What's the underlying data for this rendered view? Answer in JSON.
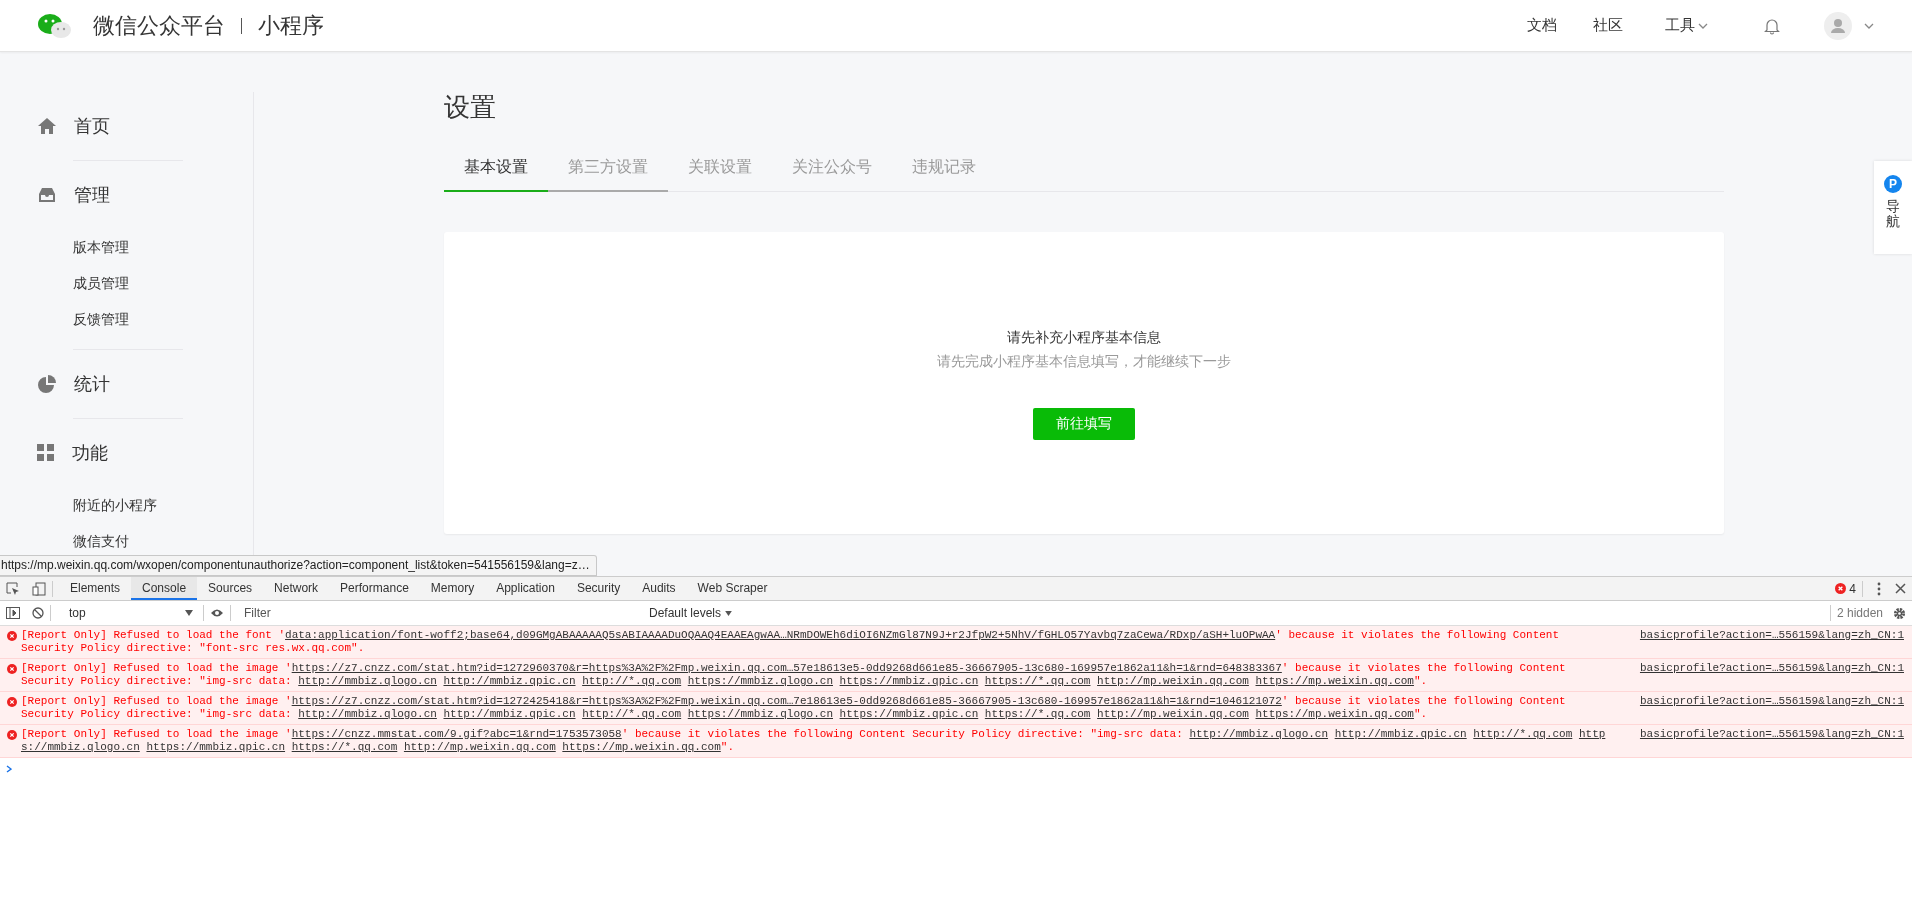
{
  "header": {
    "brand": "微信公众平台",
    "product": "小程序",
    "nav": [
      {
        "label": "文档",
        "kind": "link"
      },
      {
        "label": "社区",
        "kind": "link"
      },
      {
        "label": "工具",
        "kind": "menu"
      }
    ]
  },
  "sidebar": {
    "sections": [
      {
        "label": "首页"
      },
      {
        "label": "管理",
        "children": [
          {
            "label": "版本管理"
          },
          {
            "label": "成员管理"
          },
          {
            "label": "反馈管理"
          }
        ]
      },
      {
        "label": "统计"
      },
      {
        "label": "功能",
        "children": [
          {
            "label": "附近的小程序"
          },
          {
            "label": "微信支付"
          }
        ]
      }
    ]
  },
  "page": {
    "title": "设置",
    "tabs": [
      {
        "label": "基本设置",
        "selected": true,
        "hovered": false
      },
      {
        "label": "第三方设置",
        "selected": false,
        "hovered": true
      },
      {
        "label": "关联设置",
        "selected": false,
        "hovered": false
      },
      {
        "label": "关注公众号",
        "selected": false,
        "hovered": false
      },
      {
        "label": "违规记录",
        "selected": false,
        "hovered": false
      }
    ],
    "card": {
      "title": "请先补充小程序基本信息",
      "subtitle": "请先完成小程序基本信息填写，才能继续下一步",
      "button": "前往填写"
    }
  },
  "float_nav": {
    "badge": "P",
    "label": "导航"
  },
  "status_url": "https://mp.weixin.qq.com/wxopen/componentunauthorize?action=component_list&token=541556159&lang=z…",
  "devtools": {
    "tabs": [
      {
        "label": "Elements",
        "selected": false
      },
      {
        "label": "Console",
        "selected": true
      },
      {
        "label": "Sources",
        "selected": false
      },
      {
        "label": "Network",
        "selected": false
      },
      {
        "label": "Performance",
        "selected": false
      },
      {
        "label": "Memory",
        "selected": false
      },
      {
        "label": "Application",
        "selected": false
      },
      {
        "label": "Security",
        "selected": false
      },
      {
        "label": "Audits",
        "selected": false
      },
      {
        "label": "Web Scraper",
        "selected": false
      }
    ],
    "error_count": "4",
    "context": "top",
    "filter": {
      "placeholder": "Filter"
    },
    "levels": "Default levels",
    "hidden": "2 hidden",
    "messages": [
      {
        "source": "basicprofile?action=…556159&lang=zh_CN:1",
        "lines": [
          [
            {
              "kind": "text",
              "t": "[Report Only] Refused to load the font '"
            },
            {
              "kind": "link",
              "t": "data:application/font-woff2;base64,d09GMgABAAAAAQ5sABIAAAADuOQAAQ4EAAEAgwAA…NRmDOWEh6diOI6NZmGl87N9J+r2JfpW2+5NhV/fGHLO57Yavbq7zaCewa/RDxp/aSH+luOPwAA"
            },
            {
              "kind": "text",
              "t": "' because it violates the following Content"
            }
          ],
          [
            {
              "kind": "text",
              "t": "Security Policy directive: \"font-src res.wx.qq.com\"."
            }
          ]
        ]
      },
      {
        "source": "basicprofile?action=…556159&lang=zh_CN:1",
        "lines": [
          [
            {
              "kind": "text",
              "t": "[Report Only] Refused to load the image '"
            },
            {
              "kind": "link",
              "t": "https://z7.cnzz.com/stat.htm?id=1272960370&r=https%3A%2F%2Fmp.weixin.qq.com…57e18613e5-0dd9268d661e85-36667905-13c680-169957e1862a11&h=1&rnd=648383367"
            },
            {
              "kind": "text",
              "t": "' because it violates the following Content"
            }
          ],
          [
            {
              "kind": "text",
              "t": "Security Policy directive: \"img-src data: "
            },
            {
              "kind": "link",
              "t": "http://mmbiz.qlogo.cn"
            },
            {
              "kind": "link",
              "t": "http://mmbiz.qpic.cn"
            },
            {
              "kind": "link",
              "t": "http://*.qq.com"
            },
            {
              "kind": "link",
              "t": "https://mmbiz.qlogo.cn"
            },
            {
              "kind": "link",
              "t": "https://mmbiz.qpic.cn"
            },
            {
              "kind": "link",
              "t": "https://*.qq.com"
            },
            {
              "kind": "link",
              "t": "http://mp.weixin.qq.com"
            },
            {
              "kind": "link",
              "t": "https://mp.weixin.qq.com"
            },
            {
              "kind": "text",
              "t": "\"."
            }
          ]
        ]
      },
      {
        "source": "basicprofile?action=…556159&lang=zh_CN:1",
        "lines": [
          [
            {
              "kind": "text",
              "t": "[Report Only] Refused to load the image '"
            },
            {
              "kind": "link",
              "t": "https://z7.cnzz.com/stat.htm?id=1272425418&r=https%3A%2F%2Fmp.weixin.qq.com…7e18613e5-0dd9268d661e85-36667905-13c680-169957e1862a11&h=1&rnd=1046121072"
            },
            {
              "kind": "text",
              "t": "' because it violates the following Content"
            }
          ],
          [
            {
              "kind": "text",
              "t": "Security Policy directive: \"img-src data: "
            },
            {
              "kind": "link",
              "t": "http://mmbiz.qlogo.cn"
            },
            {
              "kind": "link",
              "t": "http://mmbiz.qpic.cn"
            },
            {
              "kind": "link",
              "t": "http://*.qq.com"
            },
            {
              "kind": "link",
              "t": "https://mmbiz.qlogo.cn"
            },
            {
              "kind": "link",
              "t": "https://mmbiz.qpic.cn"
            },
            {
              "kind": "link",
              "t": "https://*.qq.com"
            },
            {
              "kind": "link",
              "t": "http://mp.weixin.qq.com"
            },
            {
              "kind": "link",
              "t": "https://mp.weixin.qq.com"
            },
            {
              "kind": "text",
              "t": "\"."
            }
          ]
        ]
      },
      {
        "source": "basicprofile?action=…556159&lang=zh_CN:1",
        "lines": [
          [
            {
              "kind": "text",
              "t": "[Report Only] Refused to load the image '"
            },
            {
              "kind": "link",
              "t": "https://cnzz.mmstat.com/9.gif?abc=1&rnd=1753573058"
            },
            {
              "kind": "text",
              "t": "' because it violates the following Content Security Policy directive: \"img-src data: "
            },
            {
              "kind": "link",
              "t": "http://mmbiz.qlogo.cn"
            },
            {
              "kind": "link",
              "t": "http://mmbiz.qpic.cn"
            },
            {
              "kind": "link",
              "t": "http://*.qq.com"
            },
            {
              "kind": "link",
              "t": "http"
            }
          ],
          [
            {
              "kind": "link",
              "t": "s://mmbiz.qlogo.cn"
            },
            {
              "kind": "link",
              "t": "https://mmbiz.qpic.cn"
            },
            {
              "kind": "link",
              "t": "https://*.qq.com"
            },
            {
              "kind": "link",
              "t": "http://mp.weixin.qq.com"
            },
            {
              "kind": "link",
              "t": "https://mp.weixin.qq.com"
            },
            {
              "kind": "text",
              "t": "\"."
            }
          ]
        ]
      }
    ]
  }
}
